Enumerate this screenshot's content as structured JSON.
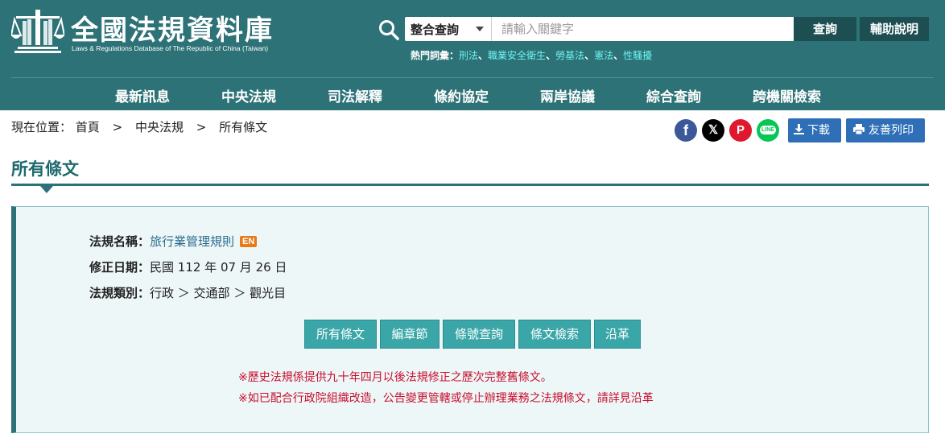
{
  "header": {
    "title": "全國法規資料庫",
    "subtitle": "Laws & Regulations Database of The Republic of China (Taiwan)",
    "search": {
      "select_value": "整合查詢",
      "placeholder": "請輸入關鍵字",
      "query_label": "查詢",
      "help_label": "輔助說明"
    },
    "hot": {
      "label": "熱門詞彙：",
      "terms": [
        "刑法",
        "職業安全衛生",
        "勞基法",
        "憲法",
        "性騷擾"
      ],
      "separator": "、"
    },
    "nav": [
      "最新訊息",
      "中央法規",
      "司法解釋",
      "條約協定",
      "兩岸協議",
      "綜合查詢",
      "跨機關檢索"
    ]
  },
  "breadcrumb": {
    "label": "現在位置：",
    "items": [
      "首頁",
      "中央法規",
      "所有條文"
    ],
    "separator": ">"
  },
  "share": {
    "facebook": "f",
    "x": "𝕏",
    "plurk": "P",
    "line": "LINE"
  },
  "actions": {
    "download_label": "下載",
    "print_label": "友善列印"
  },
  "page": {
    "title": "所有條文"
  },
  "law": {
    "name_label": "法規名稱：",
    "name_value": "旅行業管理規則",
    "en_badge": "EN",
    "date_label": "修正日期：",
    "date_value": "民國 112 年 07 月 26 日",
    "category_label": "法規類別：",
    "category_value": "行政 ＞ 交通部 ＞ 觀光目"
  },
  "tabs": [
    "所有條文",
    "編章節",
    "條號查詢",
    "條文檢索",
    "沿革"
  ],
  "notes": [
    "※歷史法規係提供九十年四月以後法規修正之歷次完整舊條文。",
    "※如已配合行政院組織改造，公告變更管轄或停止辦理業務之法規條文，請詳見沿革"
  ],
  "colors": {
    "header_bg": "#2d7277",
    "hot_term": "#6ff3f0",
    "tab_bg": "#3aa6a8",
    "note_red": "#c8102e",
    "action_blue": "#2f6fb7"
  }
}
